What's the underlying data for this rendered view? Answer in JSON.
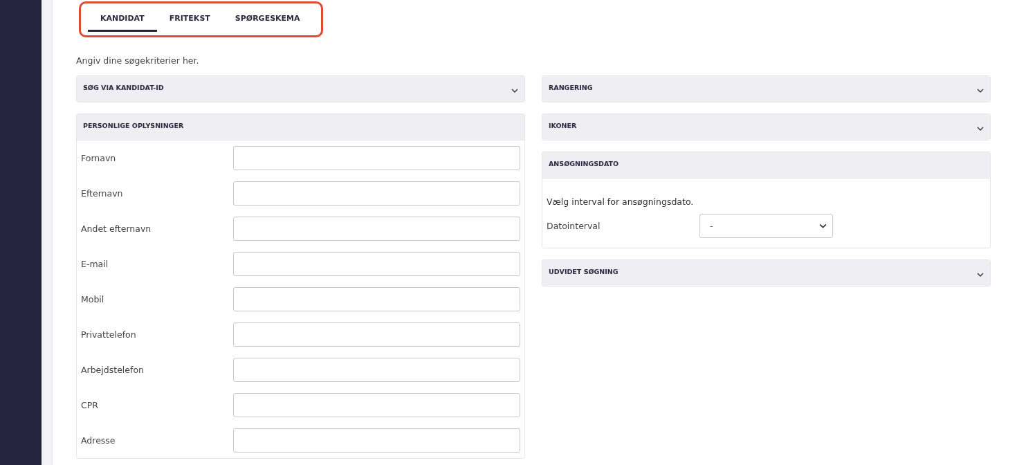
{
  "tabs": [
    {
      "label": "KANDIDAT",
      "selected": true
    },
    {
      "label": "FRITEKST",
      "selected": false
    },
    {
      "label": "SPØRGESKEMA",
      "selected": false
    }
  ],
  "intro": "Angiv dine søgekriterier her.",
  "left_panels": [
    {
      "title": "SØG VIA KANDIDAT-ID",
      "expanded": false
    },
    {
      "title": "PERSONLIGE OPLYSNINGER",
      "expanded": true,
      "kind": "fields",
      "fields": [
        {
          "label": "Fornavn"
        },
        {
          "label": "Efternavn"
        },
        {
          "label": "Andet efternavn"
        },
        {
          "label": "E-mail"
        },
        {
          "label": "Mobil"
        },
        {
          "label": "Privattelefon"
        },
        {
          "label": "Arbejdstelefon"
        },
        {
          "label": "CPR"
        },
        {
          "label": "Adresse"
        }
      ]
    }
  ],
  "right_panels": [
    {
      "title": "RANGERING",
      "expanded": false
    },
    {
      "title": "IKONER",
      "expanded": false
    },
    {
      "title": "ANSØGNINGSDATO",
      "expanded": true,
      "kind": "date",
      "description": "Vælg interval for ansøgningsdato.",
      "select": {
        "label": "Datointerval",
        "value": "-"
      }
    },
    {
      "title": "UDVIDET SØGNING",
      "expanded": false
    }
  ]
}
